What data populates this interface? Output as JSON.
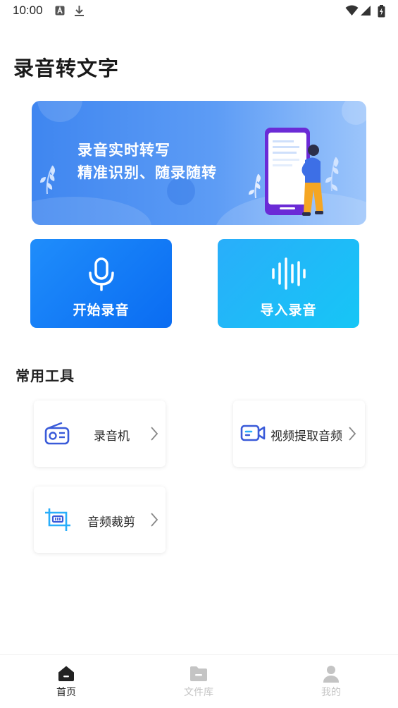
{
  "status_bar": {
    "time": "10:00",
    "icons": [
      "a-notification-icon",
      "download-icon",
      "wifi-icon",
      "signal-icon",
      "battery-charging-icon"
    ]
  },
  "page_title": "录音转文字",
  "banner": {
    "line1": "录音实时转写",
    "line2": "精准识别、随录随转"
  },
  "actions": [
    {
      "label": "开始录音",
      "icon": "microphone-icon",
      "color": "#0d73f4"
    },
    {
      "label": "导入录音",
      "icon": "waveform-icon",
      "color": "#1dbcf7"
    }
  ],
  "tools": {
    "title": "常用工具",
    "items": [
      {
        "label": "录音机",
        "icon": "radio-icon"
      },
      {
        "label": "视频提取音频",
        "icon": "video-camera-icon"
      },
      {
        "label": "音频裁剪",
        "icon": "crop-icon"
      }
    ]
  },
  "bottom_nav": {
    "items": [
      {
        "label": "首页",
        "icon": "home-icon",
        "active": true
      },
      {
        "label": "文件库",
        "icon": "folder-icon",
        "active": false
      },
      {
        "label": "我的",
        "icon": "person-icon",
        "active": false
      }
    ],
    "active_color": "#222222",
    "inactive_color": "#c4c4c4"
  },
  "colors": {
    "accent": "#1677f5",
    "banner_start": "#3f86f0",
    "banner_end": "#9cc5fb"
  }
}
